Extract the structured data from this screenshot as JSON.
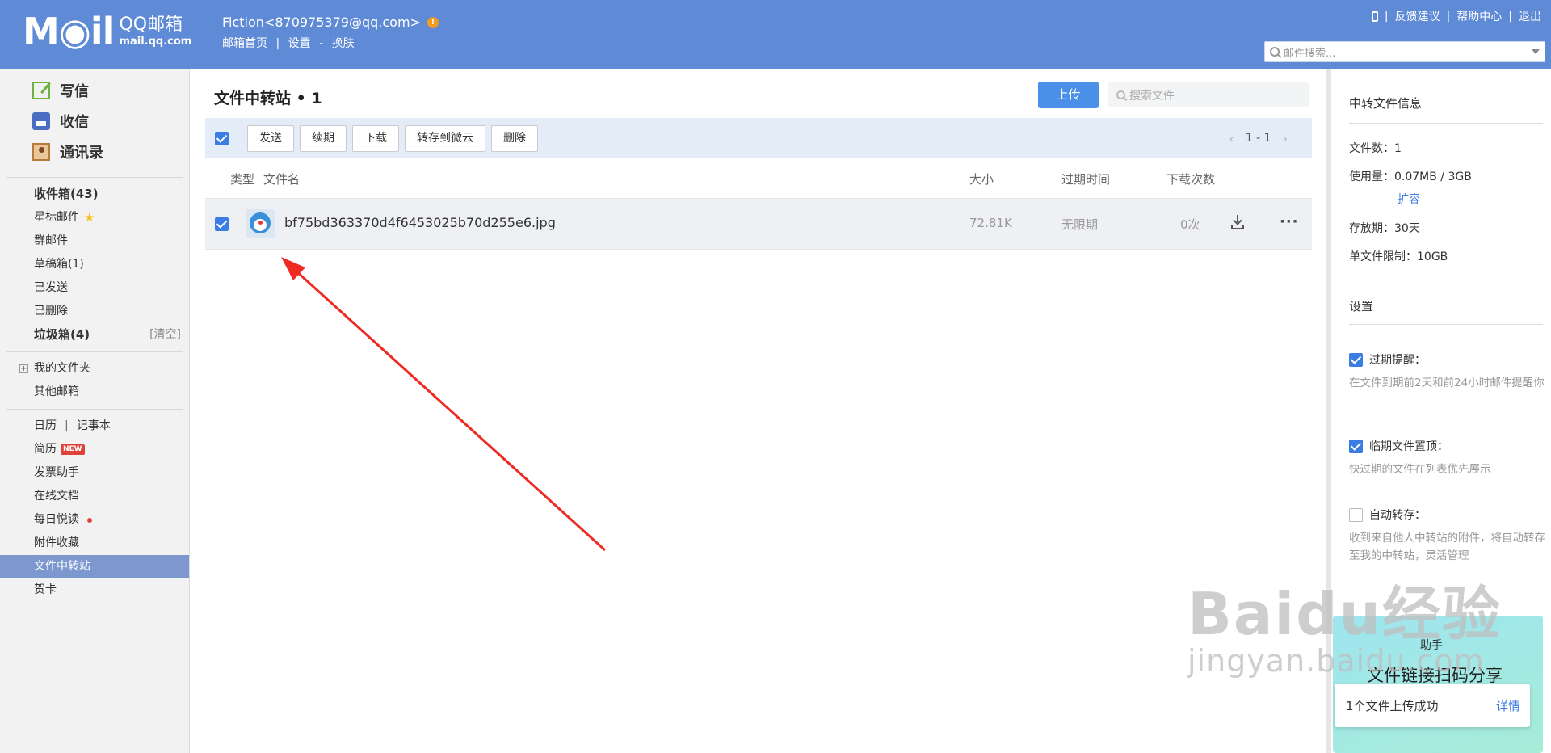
{
  "header": {
    "logo_text": "M◉il",
    "logo_qq": "QQ邮箱",
    "logo_domain": "mail.qq.com",
    "account": "Fiction<870975379@qq.com>",
    "warn_glyph": "!",
    "links": [
      "邮箱首页",
      "|",
      "设置",
      "-",
      "换肤"
    ],
    "top_links": [
      "反馈建议",
      "|",
      "帮助中心",
      "|",
      "退出"
    ],
    "top_sep": "|",
    "search_placeholder": "邮件搜索..."
  },
  "sidebar": {
    "compose": "写信",
    "inbox": "收信",
    "contacts": "通讯录",
    "folders": [
      {
        "label": "收件箱(43)"
      },
      {
        "label": "星标邮件"
      },
      {
        "label": "群邮件"
      },
      {
        "label": "草稿箱(1)"
      },
      {
        "label": "已发送"
      },
      {
        "label": "已删除"
      },
      {
        "label": "垃圾箱(4)"
      }
    ],
    "clear": "[清空]",
    "star_glyph": "★",
    "plus_glyph": "+",
    "my_folders": "我的文件夹",
    "other_mail": "其他邮箱",
    "calendar": "日历",
    "sep": "|",
    "notebook": "记事本",
    "apps": [
      {
        "label": "简历"
      },
      {
        "label": "发票助手"
      },
      {
        "label": "在线文档"
      },
      {
        "label": "每日悦读"
      },
      {
        "label": "附件收藏"
      },
      {
        "label": "文件中转站"
      },
      {
        "label": "贺卡"
      }
    ],
    "new_badge": "NEW"
  },
  "main": {
    "title": "文件中转站 • 1",
    "upload": "上传",
    "search_placeholder": "搜索文件",
    "buttons": [
      "发送",
      "续期",
      "下载",
      "转存到微云",
      "删除"
    ],
    "pager": "1 - 1",
    "pager_prev": "‹",
    "pager_next": "›",
    "columns": {
      "type": "类型",
      "name": "文件名",
      "size": "大小",
      "expire": "过期时间",
      "downloads": "下载次数"
    },
    "files": [
      {
        "name": "bf75bd363370d4f6453025b70d255e6.jpg",
        "size": "72.81K",
        "expire": "无限期",
        "downloads": "0次",
        "checked": true
      }
    ],
    "more_glyph": "···"
  },
  "annotation": {
    "arrow_color": "#ee2a22"
  },
  "right_panel": {
    "title": "中转文件信息",
    "file_count": "文件数：1",
    "usage": "使用量：0.07MB / 3GB",
    "expand": "扩容",
    "retention": "存放期：30天",
    "limit": "单文件限制：10GB",
    "settings_title": "设置",
    "options": [
      {
        "label": "过期提醒：",
        "checked": true,
        "desc": "在文件到期前2天和前24小时邮件提醒你"
      },
      {
        "label": "临期文件置顶：",
        "checked": true,
        "desc": "快过期的文件在列表优先展示"
      },
      {
        "label": "自动转存：",
        "checked": false,
        "desc": "收到来自他人中转站的附件，将自动转存至我的中转站，灵活管理"
      }
    ],
    "promo_top": "助手",
    "promo_title": "文件链接扫码分享",
    "toast_text": "1个文件上传成功",
    "toast_link": "详情"
  },
  "watermark": {
    "big": "Baidu经验",
    "small": "jingyan.baidu.com"
  },
  "colors": {
    "header_bg": "#5f8ad6",
    "accent": "#3b7de3",
    "active_nav": "#7c98cf",
    "arrow": "#ee2a22"
  }
}
